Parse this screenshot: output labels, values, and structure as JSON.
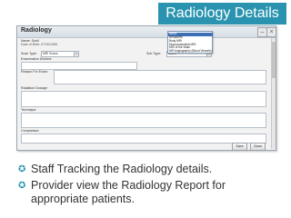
{
  "slide": {
    "title": "Radiology Details",
    "accent_color": "#2a94b0",
    "bullets": [
      {
        "icon": "bullet-icon",
        "text": "Staff Tracking the Radiology details."
      },
      {
        "icon": "bullet-icon",
        "text": "Provider view the Radiology Report for appropriate patients."
      }
    ]
  },
  "app": {
    "title": "Radiology",
    "patient": {
      "name_label": "Name: Sunil",
      "dob_label": "Date of Birth: 07/30/1985",
      "patient_id_label": "Patient ID: 7",
      "facility_label": "Facility: EHR"
    },
    "fields": {
      "scan_type_label": "Scan Type:",
      "scan_type_value": "MRI Scans",
      "sub_type_label": "Sub Type:",
      "sub_type_value": "select",
      "exam_desired_label": "Examination Desired:",
      "reason_label": "Reason For Exam:",
      "radiation_label": "Radiation Dosage:",
      "technique_label": "Technique:",
      "comparison_label": "Comparison:"
    },
    "dropdown_options": [
      "select",
      "BreastMRI",
      "Body MRI",
      "Musculoskeletal MRI",
      "MRI of the Brain",
      "MR Angiography (Blood Vessels)"
    ],
    "buttons": {
      "save": "Save",
      "cancel": "Close"
    }
  }
}
